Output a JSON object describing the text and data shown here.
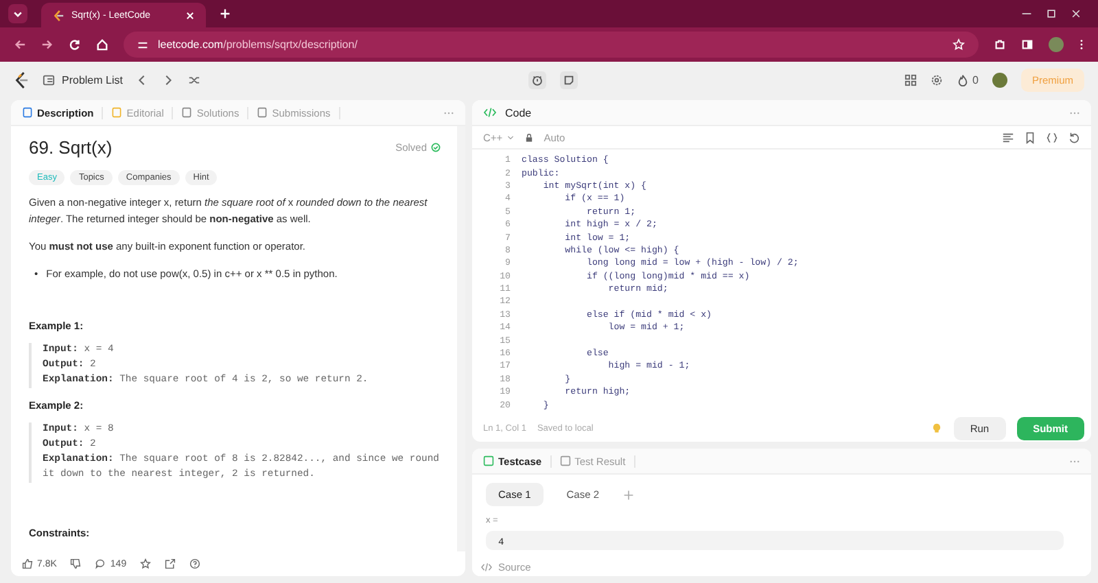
{
  "browser": {
    "tab_title": "Sqrt(x) - LeetCode",
    "url_host": "leetcode.com",
    "url_path": "/problems/sqrtx/description/"
  },
  "nav": {
    "problem_list": "Problem List",
    "streak": "0",
    "premium": "Premium"
  },
  "left_tabs": [
    {
      "label": "Description",
      "selected": true
    },
    {
      "label": "Editorial",
      "selected": false
    },
    {
      "label": "Solutions",
      "selected": false
    },
    {
      "label": "Submissions",
      "selected": false
    }
  ],
  "problem": {
    "title": "69. Sqrt(x)",
    "status": "Solved",
    "difficulty": "Easy",
    "tags": [
      "Topics",
      "Companies",
      "Hint"
    ],
    "paragraphs": [
      "Given a non-negative integer x, return *the square root of* x *rounded down to the nearest integer*. The returned integer should be **non-negative** as well.",
      "You **must not use** any built-in exponent function or operator."
    ],
    "bullets": [
      {
        "marker": "•",
        "text": "For example, do not use pow(x, 0.5) in c++ or x ** 0.5 in python."
      }
    ],
    "examples": [
      {
        "heading": "Example 1:",
        "lines": [
          "**Input:** x = 4",
          "**Output:** 2",
          "**Explanation:** The square root of 4 is 2, so we return 2."
        ]
      },
      {
        "heading": "Example 2:",
        "lines": [
          "**Input:** x = 8",
          "**Output:** 2",
          "**Explanation:** The square root of 8 is 2.82842..., and since we round it down to the nearest integer, 2 is returned."
        ]
      }
    ],
    "constraints_heading": "Constraints:"
  },
  "footer": {
    "likes": "7.8K",
    "comments": "149"
  },
  "code_panel": {
    "title": "Code",
    "language": "C++",
    "mode": "Auto",
    "lines": [
      {
        "number": "1",
        "text": "class Solution {"
      },
      {
        "number": "2",
        "text": "public:"
      },
      {
        "number": "3",
        "text": "    int mySqrt(int x) {"
      },
      {
        "number": "4",
        "text": "        if (x == 1)"
      },
      {
        "number": "5",
        "text": "            return 1;"
      },
      {
        "number": "6",
        "text": "        int high = x / 2;"
      },
      {
        "number": "7",
        "text": "        int low = 1;"
      },
      {
        "number": "8",
        "text": "        while (low <= high) {"
      },
      {
        "number": "9",
        "text": "            long long mid = low + (high - low) / 2;"
      },
      {
        "number": "10",
        "text": "            if ((long long)mid * mid == x)"
      },
      {
        "number": "11",
        "text": "                return mid;"
      },
      {
        "number": "12"
      },
      {
        "number": "13",
        "text": "            else if (mid * mid < x)"
      },
      {
        "number": "14",
        "text": "                low = mid + 1;"
      },
      {
        "number": "15"
      },
      {
        "number": "16",
        "text": "            else"
      },
      {
        "number": "17",
        "text": "                high = mid - 1;"
      },
      {
        "number": "18",
        "text": "        }"
      },
      {
        "number": "19",
        "text": "        return high;"
      },
      {
        "number": "20",
        "text": "    }"
      }
    ],
    "cursor": "Ln 1, Col 1",
    "save_status": "Saved to local",
    "run": "Run",
    "submit": "Submit"
  },
  "test_tabs": [
    {
      "label": "Testcase",
      "selected": true
    },
    {
      "label": "Test Result",
      "selected": false
    }
  ],
  "cases": [
    {
      "label": "Case 1",
      "selected": true
    },
    {
      "label": "Case 2",
      "selected": false
    }
  ],
  "input_label": "x =",
  "input_value": "4",
  "source": "Source"
}
